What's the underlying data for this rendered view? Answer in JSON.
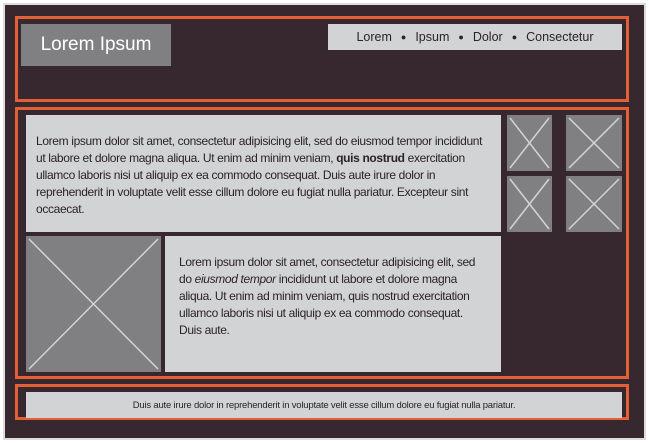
{
  "header": {
    "logo": "Lorem Ipsum",
    "nav": [
      "Lorem",
      "Ipsum",
      "Dolor",
      "Consectetur"
    ]
  },
  "main": {
    "text1": {
      "before": "Lorem ipsum dolor sit amet, consectetur adipisicing elit, sed do eiusmod tempor incididunt ut labore et dolore magna aliqua. Ut enim ad minim veniam, ",
      "bold": "quis nostrud",
      "after": " exercitation ullamco laboris nisi ut aliquip ex ea commodo consequat. Duis aute irure dolor in reprehenderit in voluptate velit esse cillum dolore eu fugiat nulla pariatur. Excepteur sint occaecat."
    },
    "text2": {
      "before": "Lorem ipsum dolor sit amet, consectetur adipisicing elit, sed do ",
      "italic": "eiusmod tempor",
      "after": " incididunt ut labore et dolore magna aliqua. Ut enim ad minim veniam, quis nostrud exercitation ullamco laboris nisi ut aliquip ex ea commodo consequat. Duis aute."
    }
  },
  "footer": {
    "text": "Duis aute irure dolor in reprehenderit in voluptate velit esse cillum dolore eu fugiat nulla pariatur."
  },
  "colors": {
    "background": "#37272e",
    "accent": "#e35f35",
    "placeholder": "#808082",
    "panel": "#d1d3d4"
  }
}
